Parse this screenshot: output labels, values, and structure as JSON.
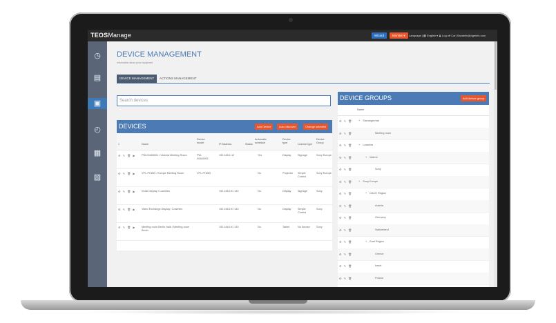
{
  "app": {
    "brand_bold": "TEOS",
    "brand_rest": "Manage"
  },
  "topbar": {
    "wizard_label": "Wizard",
    "monitor_label": "Monitor ▾",
    "links": "Language | ▩ English ▾   ♟  Log off Carl.Sandelin@dgeinfo.com"
  },
  "sidebar": {
    "items": [
      {
        "icon": "dashboard-icon",
        "glyph": "◷"
      },
      {
        "icon": "reports-icon",
        "glyph": "▤"
      },
      {
        "icon": "devices-icon",
        "glyph": "▣"
      },
      {
        "icon": "schedule-icon",
        "glyph": "◴"
      },
      {
        "icon": "content-icon",
        "glyph": "▦"
      },
      {
        "icon": "media-icon",
        "glyph": "▨"
      }
    ]
  },
  "page": {
    "title": "DEVICE MANAGEMENT",
    "subtitle": "Information about your equipment"
  },
  "tabs": [
    "DEVICE MANAGEMENT",
    "ACTIONS MANAGEMENT"
  ],
  "search": {
    "placeholder": "Search devices"
  },
  "devices": {
    "title": "DEVICES",
    "buttons": {
      "add": "Add Device",
      "auto": "Auto discover",
      "change": "Change selected"
    },
    "columns": [
      "Name",
      "Device model",
      "IP Address",
      "Status",
      "Automatic schedule",
      "Device type",
      "License type",
      "Device Group"
    ],
    "rows": [
      {
        "name": "PW-00483001 / Victoria Meeting Room",
        "model": "PW-00483001",
        "ip": "192.168.1.12",
        "status": "",
        "auto": "Yes",
        "type": "Display",
        "license": "Signage",
        "group": "Sony Europe"
      },
      {
        "name": "VPL-PHZ60 / Europe Meeting Room",
        "model": "VPL-PHZ60",
        "ip": "",
        "status": "",
        "auto": "No",
        "type": "Projector",
        "license": "Simple Control",
        "group": "Sony Europe"
      },
      {
        "name": "Kiosk Display / Lowmles",
        "model": "",
        "ip": "192.168.197.133",
        "status": "",
        "auto": "No",
        "type": "Display",
        "license": "Signage",
        "group": "Sony"
      },
      {
        "name": "Video Exchange Display / Lowmles",
        "model": "",
        "ip": "192.168.197.133",
        "status": "",
        "auto": "No",
        "type": "Display",
        "license": "Simple Control",
        "group": "Sony"
      },
      {
        "name": "Meeting room Berlin Halb / Meeting room Berlin",
        "model": "",
        "ip": "192.168.197.133",
        "status": "",
        "auto": "No",
        "type": "Tablet",
        "license": "No license",
        "group": "Sony"
      }
    ]
  },
  "groups": {
    "title": "DEVICE GROUPS",
    "add_label": "Add device group",
    "column": "Name",
    "rows": [
      {
        "name": "Stavanger/aar",
        "indent": 0,
        "expand": "+"
      },
      {
        "name": "Meeting room",
        "indent": 2,
        "expand": ""
      },
      {
        "name": "Lowmles",
        "indent": 0,
        "expand": "+"
      },
      {
        "name": "Malmö",
        "indent": 1,
        "expand": "+"
      },
      {
        "name": "Sony",
        "indent": 2,
        "expand": ""
      },
      {
        "name": "Sony Europe",
        "indent": 0,
        "expand": "+"
      },
      {
        "name": "DACH Region",
        "indent": 1,
        "expand": "+"
      },
      {
        "name": "Austria",
        "indent": 2,
        "expand": ""
      },
      {
        "name": "Germany",
        "indent": 2,
        "expand": ""
      },
      {
        "name": "Switzerland",
        "indent": 2,
        "expand": ""
      },
      {
        "name": "East Region",
        "indent": 1,
        "expand": "+"
      },
      {
        "name": "Greece",
        "indent": 2,
        "expand": ""
      },
      {
        "name": "Israel",
        "indent": 2,
        "expand": ""
      },
      {
        "name": "Poland",
        "indent": 2,
        "expand": ""
      }
    ]
  },
  "icons": {
    "row_actions": "⚙ ✎ 🗑 ▶",
    "group_actions": "⚙ ✎ 🗑"
  },
  "colors": {
    "accent": "#4b7ab4",
    "action": "#e8562e",
    "sidebar": "#5a6678",
    "topbar": "#2b2b2b"
  }
}
